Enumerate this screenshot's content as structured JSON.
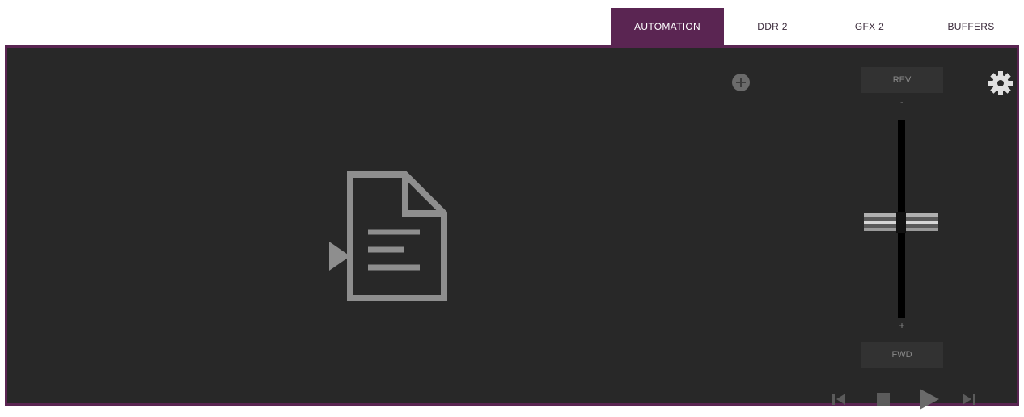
{
  "tabs": [
    {
      "label": "AUTOMATION",
      "active": true
    },
    {
      "label": "DDR 2",
      "active": false
    },
    {
      "label": "GFX 2",
      "active": false
    },
    {
      "label": "BUFFERS",
      "active": false
    }
  ],
  "controls": {
    "rev_label": "REV",
    "fwd_label": "FWD",
    "minus_sign": "-",
    "plus_sign": "+"
  },
  "icons": {
    "add": "plus-circle-icon",
    "settings": "gear-icon",
    "placeholder": "play-document-icon",
    "transport": [
      "skip-back-icon",
      "stop-icon",
      "play-icon",
      "skip-forward-icon"
    ]
  },
  "colors": {
    "accent": "#5a2552",
    "panel_bg": "#282828",
    "icon_gray": "#8e8e8e"
  }
}
